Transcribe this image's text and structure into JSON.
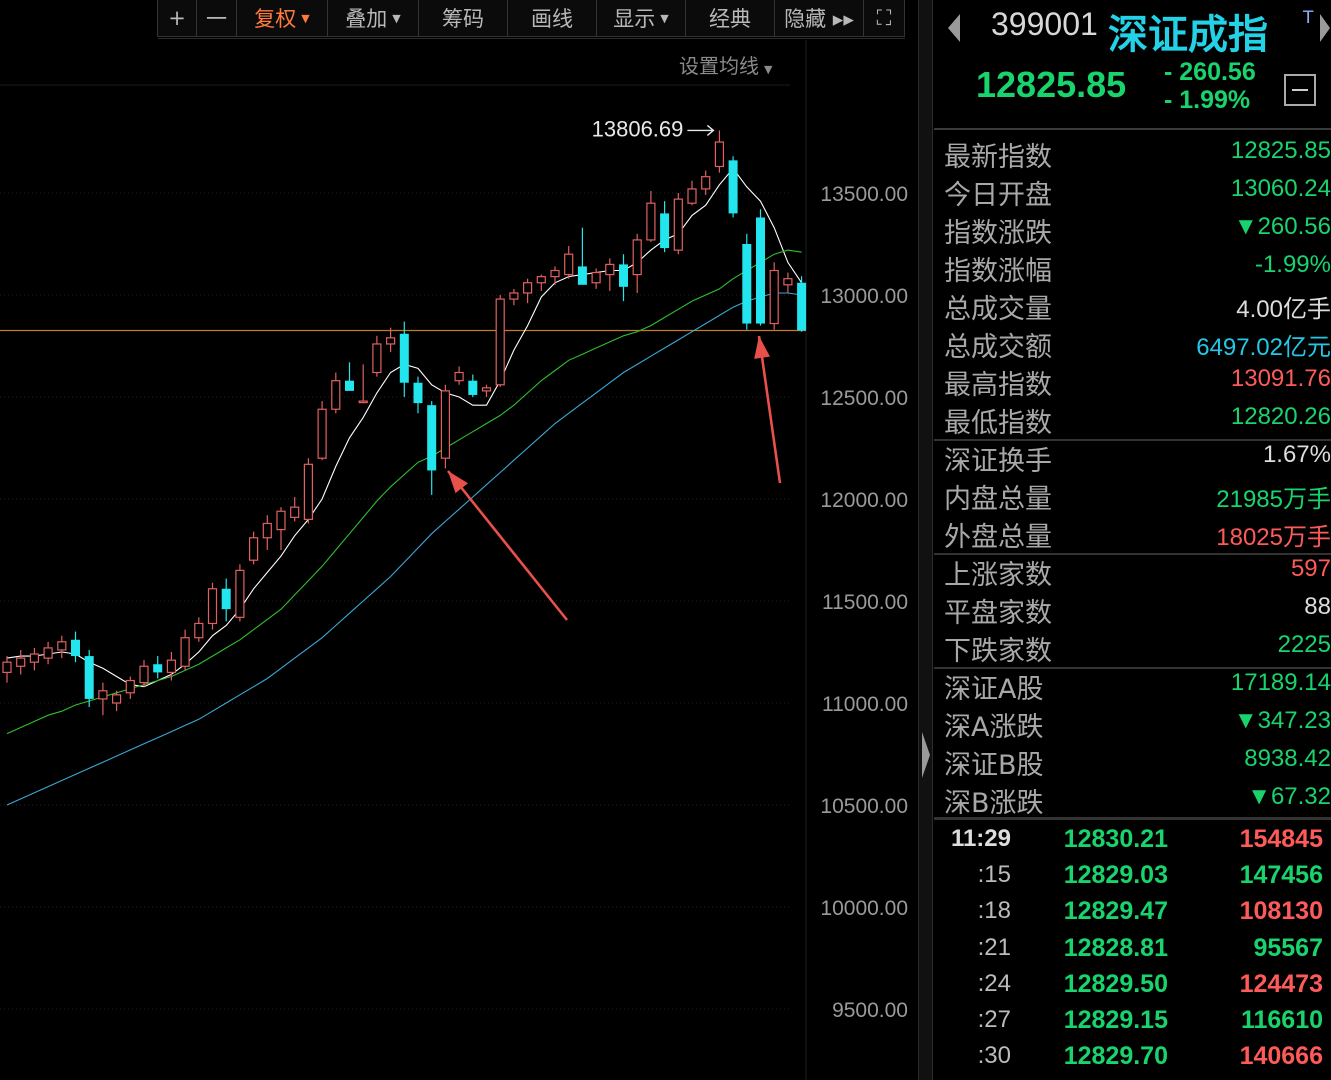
{
  "toolbar": {
    "items": [
      {
        "label": "+",
        "width": 40
      },
      {
        "label": "一",
        "width": 41
      },
      {
        "label": "复权",
        "dropdown": true,
        "active": true,
        "width": 92
      },
      {
        "label": "叠加",
        "dropdown": true,
        "width": 92
      },
      {
        "label": "筹码",
        "width": 90
      },
      {
        "label": "画线",
        "width": 90
      },
      {
        "label": "显示",
        "dropdown": true,
        "width": 90
      },
      {
        "label": "经典",
        "width": 90
      },
      {
        "label": "隐藏 ▸▸",
        "width": 90
      },
      {
        "label": "⛶",
        "width": 42
      }
    ]
  },
  "ma_setting": {
    "label": "设置均线"
  },
  "colors": {
    "up": "#ff5a5a",
    "down": "#19d46d",
    "candle_up": "#e06060",
    "candle_down": "#22e5ee",
    "ma5": "#ffffff",
    "ma10": "#2fbf2f",
    "ma20": "#3aa9d6",
    "price_line": "#c07a2a",
    "annotation_arrow": "#e8504a",
    "accent_name": "#23d2e6"
  },
  "chart_data": {
    "type": "candlestick",
    "y_axis_labels": [
      "13500.00",
      "13000.00",
      "12500.00",
      "12000.00",
      "11500.00",
      "11000.00",
      "10500.00",
      "10000.00",
      "9500.00"
    ],
    "y_ticks": [
      13500,
      13000,
      12500,
      12000,
      11500,
      11000,
      10500,
      10000,
      9500
    ],
    "ylim": [
      9210,
      13960
    ],
    "grid": true,
    "peak_label": "13806.69",
    "peak_value": 13806.69,
    "reference_price": 12825.85,
    "candles": [
      {
        "o": 11150,
        "h": 11230,
        "l": 11100,
        "c": 11200
      },
      {
        "o": 11180,
        "h": 11260,
        "l": 11140,
        "c": 11220
      },
      {
        "o": 11200,
        "h": 11270,
        "l": 11160,
        "c": 11240
      },
      {
        "o": 11220,
        "h": 11300,
        "l": 11190,
        "c": 11270
      },
      {
        "o": 11260,
        "h": 11330,
        "l": 11220,
        "c": 11300
      },
      {
        "o": 11310,
        "h": 11350,
        "l": 11200,
        "c": 11230
      },
      {
        "o": 11230,
        "h": 11260,
        "l": 10980,
        "c": 11020
      },
      {
        "o": 11020,
        "h": 11100,
        "l": 10940,
        "c": 11060
      },
      {
        "o": 11000,
        "h": 11060,
        "l": 10960,
        "c": 11040
      },
      {
        "o": 11050,
        "h": 11130,
        "l": 11020,
        "c": 11110
      },
      {
        "o": 11100,
        "h": 11210,
        "l": 11080,
        "c": 11180
      },
      {
        "o": 11190,
        "h": 11230,
        "l": 11120,
        "c": 11150
      },
      {
        "o": 11150,
        "h": 11250,
        "l": 11110,
        "c": 11210
      },
      {
        "o": 11180,
        "h": 11360,
        "l": 11160,
        "c": 11320
      },
      {
        "o": 11320,
        "h": 11420,
        "l": 11300,
        "c": 11390
      },
      {
        "o": 11390,
        "h": 11590,
        "l": 11360,
        "c": 11560
      },
      {
        "o": 11560,
        "h": 11610,
        "l": 11400,
        "c": 11460
      },
      {
        "o": 11420,
        "h": 11680,
        "l": 11400,
        "c": 11650
      },
      {
        "o": 11700,
        "h": 11840,
        "l": 11680,
        "c": 11810
      },
      {
        "o": 11810,
        "h": 11920,
        "l": 11750,
        "c": 11880
      },
      {
        "o": 11850,
        "h": 11960,
        "l": 11750,
        "c": 11940
      },
      {
        "o": 11910,
        "h": 12010,
        "l": 11890,
        "c": 11960
      },
      {
        "o": 11900,
        "h": 12200,
        "l": 11880,
        "c": 12170
      },
      {
        "o": 12200,
        "h": 12480,
        "l": 12190,
        "c": 12440
      },
      {
        "o": 12440,
        "h": 12620,
        "l": 12420,
        "c": 12580
      },
      {
        "o": 12580,
        "h": 12670,
        "l": 12550,
        "c": 12530
      },
      {
        "o": 12480,
        "h": 12660,
        "l": 12480,
        "c": 12480
      },
      {
        "o": 12620,
        "h": 12800,
        "l": 12600,
        "c": 12760
      },
      {
        "o": 12760,
        "h": 12840,
        "l": 12720,
        "c": 12790
      },
      {
        "o": 12810,
        "h": 12870,
        "l": 12500,
        "c": 12570
      },
      {
        "o": 12570,
        "h": 12600,
        "l": 12420,
        "c": 12470
      },
      {
        "o": 12460,
        "h": 12480,
        "l": 12020,
        "c": 12140
      },
      {
        "o": 12200,
        "h": 12560,
        "l": 12150,
        "c": 12530
      },
      {
        "o": 12580,
        "h": 12650,
        "l": 12560,
        "c": 12620
      },
      {
        "o": 12580,
        "h": 12610,
        "l": 12500,
        "c": 12510
      },
      {
        "o": 12530,
        "h": 12560,
        "l": 12500,
        "c": 12545
      },
      {
        "o": 12560,
        "h": 13000,
        "l": 12550,
        "c": 12980
      },
      {
        "o": 12980,
        "h": 13030,
        "l": 12950,
        "c": 13010
      },
      {
        "o": 13010,
        "h": 13080,
        "l": 12960,
        "c": 13060
      },
      {
        "o": 13060,
        "h": 13100,
        "l": 13020,
        "c": 13090
      },
      {
        "o": 13090,
        "h": 13140,
        "l": 13050,
        "c": 13120
      },
      {
        "o": 13100,
        "h": 13240,
        "l": 13080,
        "c": 13200
      },
      {
        "o": 13140,
        "h": 13330,
        "l": 13060,
        "c": 13050
      },
      {
        "o": 13060,
        "h": 13130,
        "l": 13030,
        "c": 13110
      },
      {
        "o": 13100,
        "h": 13180,
        "l": 13020,
        "c": 13150
      },
      {
        "o": 13150,
        "h": 13200,
        "l": 12970,
        "c": 13040
      },
      {
        "o": 13100,
        "h": 13300,
        "l": 13010,
        "c": 13270
      },
      {
        "o": 13270,
        "h": 13510,
        "l": 13260,
        "c": 13450
      },
      {
        "o": 13400,
        "h": 13460,
        "l": 13210,
        "c": 13230
      },
      {
        "o": 13220,
        "h": 13500,
        "l": 13200,
        "c": 13470
      },
      {
        "o": 13450,
        "h": 13560,
        "l": 13440,
        "c": 13520
      },
      {
        "o": 13520,
        "h": 13610,
        "l": 13490,
        "c": 13580
      },
      {
        "o": 13630,
        "h": 13806.69,
        "l": 13600,
        "c": 13750
      },
      {
        "o": 13660,
        "h": 13680,
        "l": 13380,
        "c": 13400
      },
      {
        "o": 13250,
        "h": 13300,
        "l": 12830,
        "c": 12860
      },
      {
        "o": 13380,
        "h": 13420,
        "l": 12850,
        "c": 12860
      },
      {
        "o": 12860,
        "h": 13160,
        "l": 12830,
        "c": 13120
      },
      {
        "o": 13050,
        "h": 13110,
        "l": 13010,
        "c": 13080
      },
      {
        "o": 13060,
        "h": 13092,
        "l": 12820,
        "c": 12826
      }
    ],
    "ma_series": [
      {
        "key": "ma5",
        "values": [
          11220,
          11230,
          11230,
          11240,
          11250,
          11240,
          11200,
          11170,
          11130,
          11090,
          11080,
          11110,
          11140,
          11190,
          11250,
          11330,
          11380,
          11460,
          11560,
          11640,
          11720,
          11820,
          11900,
          12000,
          12160,
          12300,
          12400,
          12520,
          12620,
          12660,
          12640,
          12560,
          12520,
          12500,
          12460,
          12460,
          12580,
          12730,
          12850,
          12990,
          13060,
          13090,
          13100,
          13110,
          13120,
          13120,
          13160,
          13220,
          13270,
          13300,
          13390,
          13440,
          13540,
          13620,
          13530,
          13460,
          13330,
          13160,
          13060
        ]
      },
      {
        "key": "ma10",
        "values": [
          10850,
          10880,
          10910,
          10940,
          10960,
          10990,
          11010,
          11030,
          11050,
          11070,
          11090,
          11110,
          11130,
          11160,
          11190,
          11230,
          11270,
          11310,
          11360,
          11410,
          11460,
          11530,
          11600,
          11670,
          11750,
          11830,
          11910,
          11990,
          12060,
          12120,
          12180,
          12210,
          12250,
          12290,
          12330,
          12370,
          12410,
          12460,
          12520,
          12580,
          12630,
          12680,
          12710,
          12740,
          12770,
          12800,
          12820,
          12850,
          12890,
          12930,
          12970,
          13000,
          13030,
          13080,
          13120,
          13160,
          13200,
          13220,
          13210
        ]
      },
      {
        "key": "ma20",
        "values": [
          10500,
          10530,
          10560,
          10590,
          10620,
          10650,
          10680,
          10710,
          10740,
          10770,
          10800,
          10830,
          10860,
          10890,
          10920,
          10960,
          11000,
          11040,
          11080,
          11120,
          11170,
          11220,
          11270,
          11320,
          11380,
          11440,
          11500,
          11560,
          11620,
          11690,
          11760,
          11830,
          11890,
          11950,
          12010,
          12070,
          12130,
          12190,
          12250,
          12310,
          12370,
          12420,
          12470,
          12520,
          12570,
          12620,
          12660,
          12700,
          12740,
          12780,
          12820,
          12860,
          12900,
          12940,
          12970,
          12990,
          13010,
          13010,
          13000
        ]
      }
    ]
  },
  "quote": {
    "code": "399001",
    "name": "深证成指",
    "t_mark": "T",
    "last_price": "12825.85",
    "change_abs": "- 260.56",
    "change_pct": "- 1.99%",
    "stats": [
      {
        "label": "最新指数",
        "value": "12825.85",
        "color": "down"
      },
      {
        "label": "今日开盘",
        "value": "13060.24",
        "color": "down"
      },
      {
        "label": "指数涨跌",
        "value": "▼260.56",
        "color": "down"
      },
      {
        "label": "指数涨幅",
        "value": "-1.99%",
        "color": "down"
      },
      {
        "label": "总成交量",
        "value": "4.00亿手",
        "color": "neutral"
      },
      {
        "label": "总成交额",
        "value": "6497.02亿元",
        "color": "cyan"
      },
      {
        "label": "最高指数",
        "value": "13091.76",
        "color": "up"
      },
      {
        "label": "最低指数",
        "value": "12820.26",
        "color": "down"
      },
      {
        "label": "深证换手",
        "value": "1.67%",
        "color": "neutral"
      },
      {
        "label": "内盘总量",
        "value": "21985万手",
        "color": "down"
      },
      {
        "label": "外盘总量",
        "value": "18025万手",
        "color": "up"
      },
      {
        "label": "上涨家数",
        "value": "597",
        "color": "up"
      },
      {
        "label": "平盘家数",
        "value": "88",
        "color": "neutral"
      },
      {
        "label": "下跌家数",
        "value": "2225",
        "color": "down"
      },
      {
        "label": "深证A股",
        "value": "17189.14",
        "color": "down"
      },
      {
        "label": "深A涨跌",
        "value": "▼347.23",
        "color": "down"
      },
      {
        "label": "深证B股",
        "value": "8938.42",
        "color": "down"
      },
      {
        "label": "深B涨跌",
        "value": "▼67.32",
        "color": "down"
      }
    ],
    "ticks": [
      {
        "time": "11:29",
        "price": "12830.21",
        "volume": "154845",
        "vol_color": "up"
      },
      {
        "time": ":15",
        "price": "12829.03",
        "volume": "147456",
        "vol_color": "down"
      },
      {
        "time": ":18",
        "price": "12829.47",
        "volume": "108130",
        "vol_color": "up"
      },
      {
        "time": ":21",
        "price": "12828.81",
        "volume": "95567",
        "vol_color": "down"
      },
      {
        "time": ":24",
        "price": "12829.50",
        "volume": "124473",
        "vol_color": "up"
      },
      {
        "time": ":27",
        "price": "12829.15",
        "volume": "116610",
        "vol_color": "down"
      },
      {
        "time": ":30",
        "price": "12829.70",
        "volume": "140666",
        "vol_color": "up"
      }
    ]
  }
}
